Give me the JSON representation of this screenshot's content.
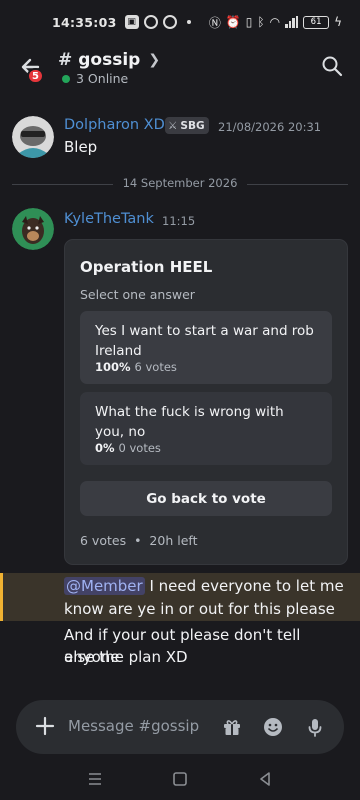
{
  "status_bar": {
    "time": "14:35:03",
    "battery": "61"
  },
  "header": {
    "back_badge": "5",
    "channel_name": "gossip",
    "online_text": "3 Online"
  },
  "messages": [
    {
      "author": "Dolpharon XD",
      "tag": "SBG",
      "timestamp": "21/08/2026 20:31",
      "text": "Blep"
    },
    {
      "author": "KyleTheTank",
      "timestamp": "11:15"
    }
  ],
  "date_divider": "14 September 2026",
  "poll": {
    "question": "Operation HEEL",
    "hint": "Select one answer",
    "options": [
      {
        "text": "Yes I want to start a war and rob Ireland",
        "percent": "100%",
        "votes": "6 votes"
      },
      {
        "text": "What the fuck is wrong with you, no",
        "percent": "0%",
        "votes": "0 votes"
      }
    ],
    "vote_button": "Go back to vote",
    "total_votes": "6 votes",
    "separator": "•",
    "time_left": "20h left"
  },
  "followups": {
    "mention": "@Member",
    "line1_rest": " I need everyone to let me",
    "line2": "know are ye in or out for this please",
    "line3": "And if your out please don't tell anyone",
    "line4": "else the plan XD"
  },
  "composer": {
    "placeholder": "Message #gossip"
  },
  "colors": {
    "background": "#1a1a1e",
    "author": "#4f8fd3",
    "mention_highlight": "#f0b232",
    "online": "#23a55a",
    "badge": "#e5363b"
  },
  "icons": [
    "back-arrow-icon",
    "search-icon",
    "plus-icon",
    "gift-icon",
    "emoji-icon",
    "microphone-icon",
    "menu-icon",
    "home-icon",
    "back-icon"
  ]
}
